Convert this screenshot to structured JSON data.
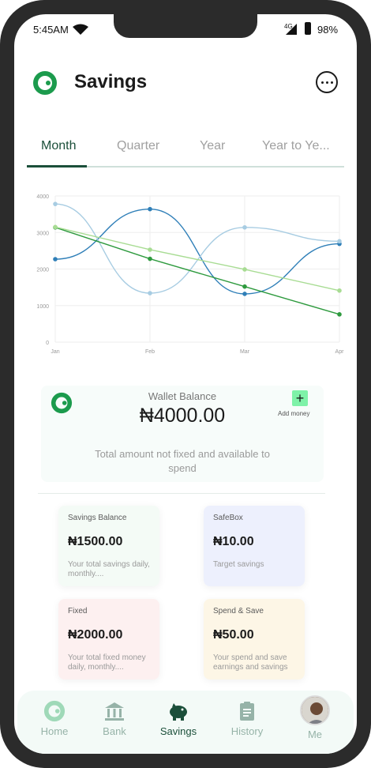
{
  "status": {
    "time": "5:45AM",
    "network": "4G",
    "battery": "98%"
  },
  "header": {
    "title": "Savings"
  },
  "tabs": [
    {
      "label": "Month",
      "active": true
    },
    {
      "label": "Quarter",
      "active": false
    },
    {
      "label": "Year",
      "active": false
    },
    {
      "label": "Year to Ye...",
      "active": false
    }
  ],
  "chart_data": {
    "type": "line",
    "categories": [
      "Jan",
      "Feb",
      "Mar",
      "Apr"
    ],
    "ylim": [
      0,
      4000
    ],
    "yticks": [
      0,
      1000,
      2000,
      3000,
      4000
    ],
    "grid": true,
    "series": [
      {
        "values": [
          2270,
          3640,
          1320,
          2690
        ],
        "color": "#2f7fb8",
        "smooth": true
      },
      {
        "values": [
          3780,
          1340,
          3140,
          2760
        ],
        "color": "#a7cce2",
        "smooth": true
      },
      {
        "values": [
          3140,
          2280,
          1520,
          760
        ],
        "color": "#2e9a3e",
        "smooth": false
      },
      {
        "values": [
          3150,
          2530,
          1990,
          1410
        ],
        "color": "#a8dc93",
        "smooth": false
      }
    ]
  },
  "wallet": {
    "label": "Wallet Balance",
    "amount": "₦4000.00",
    "add_label": "Add money",
    "description": "Total amount not fixed and available to spend"
  },
  "tiles": [
    {
      "title": "Savings Balance",
      "amount": "₦1500.00",
      "desc": "Your total savings daily, monthly....",
      "color": "#f4fbf6"
    },
    {
      "title": "SafeBox",
      "amount": "₦10.00",
      "desc": "Target savings",
      "color": "#edf0fd"
    },
    {
      "title": "Fixed",
      "amount": "₦2000.00",
      "desc": "Your total fixed money daily, monthly....",
      "color": "#fdf0f0"
    },
    {
      "title": "Spend & Save",
      "amount": "₦50.00",
      "desc": "Your spend and save earnings and savings",
      "color": "#fdf6e6"
    }
  ],
  "nav": [
    {
      "label": "Home",
      "icon": "home-logo-icon"
    },
    {
      "label": "Bank",
      "icon": "bank-icon"
    },
    {
      "label": "Savings",
      "icon": "piggy-bank-icon",
      "active": true
    },
    {
      "label": "History",
      "icon": "clipboard-icon"
    },
    {
      "label": "Me",
      "icon": "avatar"
    }
  ],
  "colors": {
    "brand": "#1b4f3a",
    "accent": "#2fbf5c"
  }
}
